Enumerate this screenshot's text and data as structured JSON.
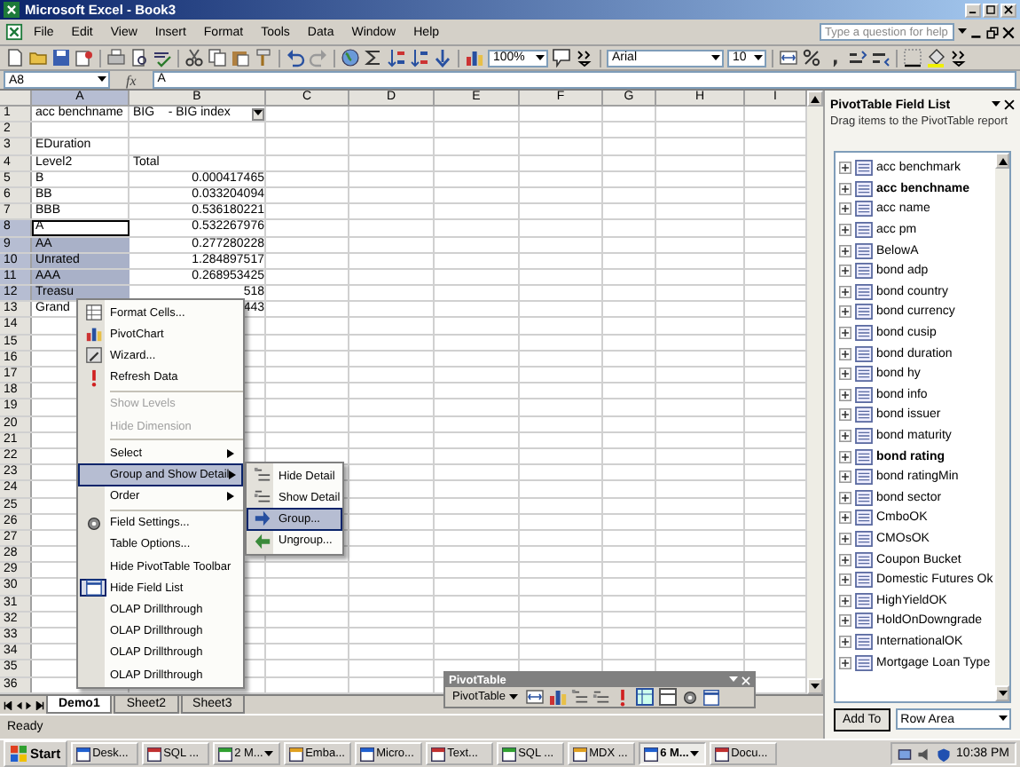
{
  "window": {
    "title": "Microsoft Excel - Book3"
  },
  "menu_bar": {
    "items": [
      "File",
      "Edit",
      "View",
      "Insert",
      "Format",
      "Tools",
      "Data",
      "Window",
      "Help"
    ],
    "help_box": {
      "placeholder": "Type a question for help"
    }
  },
  "toolbar": {
    "zoom": "100%",
    "font": "Arial",
    "font_size": "10"
  },
  "formula_bar": {
    "name_box": "A8",
    "function_label": "fx",
    "value": "A"
  },
  "columns": [
    {
      "label": "A",
      "selected": true
    },
    {
      "label": "B",
      "selected": false
    },
    {
      "label": "C",
      "selected": false
    },
    {
      "label": "D",
      "selected": false
    },
    {
      "label": "E",
      "selected": false
    },
    {
      "label": "F",
      "selected": false
    },
    {
      "label": "G",
      "selected": false
    },
    {
      "label": "H",
      "selected": false
    },
    {
      "label": "I",
      "selected": false
    }
  ],
  "rows": [
    {
      "header": "1",
      "selected": false,
      "active": false,
      "cells": [
        {
          "text": "acc benchname",
          "kind": "label"
        },
        {
          "text": "BIG    - BIG index",
          "kind": "filter"
        }
      ]
    },
    {
      "header": "2",
      "selected": false,
      "active": false
    },
    {
      "header": "3",
      "selected": false,
      "active": false,
      "cells": [
        {
          "text": "EDuration",
          "kind": "label"
        }
      ]
    },
    {
      "header": "4",
      "selected": false,
      "active": false,
      "cells": [
        {
          "text": "Level2",
          "kind": "label"
        },
        {
          "text": "Total",
          "kind": "label"
        }
      ]
    },
    {
      "header": "5",
      "selected": false,
      "active": false,
      "cells": [
        {
          "text": "B",
          "kind": "label"
        },
        {
          "text": "0.000417465",
          "kind": "number"
        }
      ]
    },
    {
      "header": "6",
      "selected": false,
      "active": false,
      "cells": [
        {
          "text": "BB",
          "kind": "label"
        },
        {
          "text": "0.033204094",
          "kind": "number"
        }
      ]
    },
    {
      "header": "7",
      "selected": false,
      "active": false,
      "cells": [
        {
          "text": "BBB",
          "kind": "label"
        },
        {
          "text": "0.536180221",
          "kind": "number"
        }
      ]
    },
    {
      "header": "8",
      "selected": true,
      "active": true,
      "cells": [
        {
          "text": "A",
          "kind": "label"
        },
        {
          "text": "0.532267976",
          "kind": "number"
        }
      ]
    },
    {
      "header": "9",
      "selected": true,
      "active": false,
      "cells": [
        {
          "text": "AA",
          "kind": "label"
        },
        {
          "text": "0.277280228",
          "kind": "number"
        }
      ]
    },
    {
      "header": "10",
      "selected": true,
      "active": false,
      "cells": [
        {
          "text": "Unrated",
          "kind": "label"
        },
        {
          "text": "1.284897517",
          "kind": "number"
        }
      ]
    },
    {
      "header": "11",
      "selected": true,
      "active": false,
      "cells": [
        {
          "text": "AAA",
          "kind": "label"
        },
        {
          "text": "0.268953425",
          "kind": "number"
        }
      ]
    },
    {
      "header": "12",
      "selected": true,
      "active": false,
      "cells": [
        {
          "text": "Treasu",
          "kind": "label"
        },
        {
          "text": "518",
          "kind": "number"
        }
      ]
    },
    {
      "header": "13",
      "selected": false,
      "active": false,
      "cells": [
        {
          "text": "Grand",
          "kind": "label"
        },
        {
          "text": "443",
          "kind": "number"
        }
      ]
    },
    {
      "header": "14",
      "selected": false,
      "active": false
    },
    {
      "header": "15",
      "selected": false,
      "active": false
    },
    {
      "header": "16",
      "selected": false,
      "active": false
    },
    {
      "header": "17",
      "selected": false,
      "active": false
    },
    {
      "header": "18",
      "selected": false,
      "active": false
    },
    {
      "header": "19",
      "selected": false,
      "active": false
    },
    {
      "header": "20",
      "selected": false,
      "active": false
    },
    {
      "header": "21",
      "selected": false,
      "active": false
    },
    {
      "header": "22",
      "selected": false,
      "active": false
    },
    {
      "header": "23",
      "selected": false,
      "active": false
    },
    {
      "header": "24",
      "selected": false,
      "active": false
    },
    {
      "header": "25",
      "selected": false,
      "active": false
    },
    {
      "header": "26",
      "selected": false,
      "active": false
    },
    {
      "header": "27",
      "selected": false,
      "active": false
    },
    {
      "header": "28",
      "selected": false,
      "active": false
    },
    {
      "header": "29",
      "selected": false,
      "active": false
    },
    {
      "header": "30",
      "selected": false,
      "active": false
    },
    {
      "header": "31",
      "selected": false,
      "active": false
    },
    {
      "header": "32",
      "selected": false,
      "active": false
    },
    {
      "header": "33",
      "selected": false,
      "active": false
    },
    {
      "header": "34",
      "selected": false,
      "active": false
    },
    {
      "header": "35",
      "selected": false,
      "active": false
    },
    {
      "header": "36",
      "selected": false,
      "active": false
    }
  ],
  "sheet_tabs": [
    {
      "label": "Demo1",
      "selected": true
    },
    {
      "label": "Sheet2",
      "selected": false
    },
    {
      "label": "Sheet3",
      "selected": false
    }
  ],
  "status_bar": {
    "text": "Ready"
  },
  "context_menu": {
    "items": [
      {
        "kind": "command",
        "label": "Format Cells...",
        "disabled": false,
        "selected": false,
        "checked": false
      },
      {
        "kind": "command",
        "label": "PivotChart",
        "disabled": false,
        "selected": false,
        "checked": false
      },
      {
        "kind": "command",
        "label": "Wizard...",
        "disabled": false,
        "selected": false,
        "checked": false
      },
      {
        "kind": "command",
        "label": "Refresh Data",
        "disabled": false,
        "selected": false,
        "checked": false
      },
      {
        "kind": "separator"
      },
      {
        "kind": "command",
        "label": "Show Levels",
        "disabled": true,
        "selected": false,
        "checked": false
      },
      {
        "kind": "command",
        "label": "Hide Dimension",
        "disabled": true,
        "selected": false,
        "checked": false
      },
      {
        "kind": "separator"
      },
      {
        "kind": "submenu",
        "label": "Select",
        "disabled": false,
        "selected": false,
        "checked": false
      },
      {
        "kind": "submenu",
        "label": "Group and Show Detail",
        "disabled": false,
        "selected": true,
        "checked": false
      },
      {
        "kind": "submenu",
        "label": "Order",
        "disabled": false,
        "selected": false,
        "checked": false
      },
      {
        "kind": "separator"
      },
      {
        "kind": "command",
        "label": "Field Settings...",
        "disabled": false,
        "selected": false,
        "checked": false
      },
      {
        "kind": "command",
        "label": "Table Options...",
        "disabled": false,
        "selected": false,
        "checked": false
      },
      {
        "kind": "command",
        "label": "Hide PivotTable Toolbar",
        "disabled": false,
        "selected": false,
        "checked": false
      },
      {
        "kind": "command",
        "label": "Hide Field List",
        "disabled": false,
        "selected": false,
        "checked": true
      },
      {
        "kind": "command",
        "label": "OLAP Drillthrough",
        "disabled": false,
        "selected": false,
        "checked": false
      },
      {
        "kind": "command",
        "label": "OLAP Drillthrough",
        "disabled": false,
        "selected": false,
        "checked": false
      },
      {
        "kind": "command",
        "label": "OLAP Drillthrough",
        "disabled": false,
        "selected": false,
        "checked": false
      },
      {
        "kind": "command",
        "label": "OLAP Drillthrough",
        "disabled": false,
        "selected": false,
        "checked": false
      }
    ]
  },
  "submenu": {
    "items": [
      {
        "label": "Hide Detail",
        "selected": false
      },
      {
        "label": "Show Detail",
        "selected": false
      },
      {
        "label": "Group...",
        "selected": true
      },
      {
        "label": "Ungroup...",
        "selected": false
      }
    ]
  },
  "pivot_toolbar": {
    "title": "PivotTable",
    "menu_label": "PivotTable"
  },
  "field_list": {
    "title": "PivotTable Field List",
    "hint": "Drag items to the PivotTable report",
    "fields": [
      {
        "name": "acc benchmark",
        "in_use": false
      },
      {
        "name": "acc benchname",
        "in_use": true
      },
      {
        "name": "acc name",
        "in_use": false
      },
      {
        "name": "acc pm",
        "in_use": false
      },
      {
        "name": "BelowA",
        "in_use": false
      },
      {
        "name": "bond adp",
        "in_use": false
      },
      {
        "name": "bond country",
        "in_use": false
      },
      {
        "name": "bond currency",
        "in_use": false
      },
      {
        "name": "bond cusip",
        "in_use": false
      },
      {
        "name": "bond duration",
        "in_use": false
      },
      {
        "name": "bond hy",
        "in_use": false
      },
      {
        "name": "bond info",
        "in_use": false
      },
      {
        "name": "bond issuer",
        "in_use": false
      },
      {
        "name": "bond maturity",
        "in_use": false
      },
      {
        "name": "bond rating",
        "in_use": true
      },
      {
        "name": "bond ratingMin",
        "in_use": false
      },
      {
        "name": "bond sector",
        "in_use": false
      },
      {
        "name": "CmboOK",
        "in_use": false
      },
      {
        "name": "CMOsOK",
        "in_use": false
      },
      {
        "name": "Coupon Bucket",
        "in_use": false
      },
      {
        "name": "Domestic Futures Ok",
        "in_use": false
      },
      {
        "name": "HighYieldOK",
        "in_use": false
      },
      {
        "name": "HoldOnDowngrade",
        "in_use": false
      },
      {
        "name": "InternationalOK",
        "in_use": false
      },
      {
        "name": "Mortgage Loan Type",
        "in_use": false
      }
    ],
    "add_button": "Add To",
    "area": "Row Area"
  },
  "taskbar": {
    "start": "Start",
    "tasks": [
      {
        "label": "Desk...",
        "selected": false,
        "grouped": false
      },
      {
        "label": "SQL ...",
        "selected": false,
        "grouped": false
      },
      {
        "label": "2 M...",
        "selected": false,
        "grouped": true
      },
      {
        "label": "Emba...",
        "selected": false,
        "grouped": false
      },
      {
        "label": "Micro...",
        "selected": false,
        "grouped": false
      },
      {
        "label": "Text...",
        "selected": false,
        "grouped": false
      },
      {
        "label": "SQL ...",
        "selected": false,
        "grouped": false
      },
      {
        "label": "MDX ...",
        "selected": false,
        "grouped": false
      },
      {
        "label": "6 M...",
        "selected": true,
        "grouped": true
      },
      {
        "label": "Docu...",
        "selected": false,
        "grouped": false
      }
    ],
    "clock": "10:38 PM"
  }
}
